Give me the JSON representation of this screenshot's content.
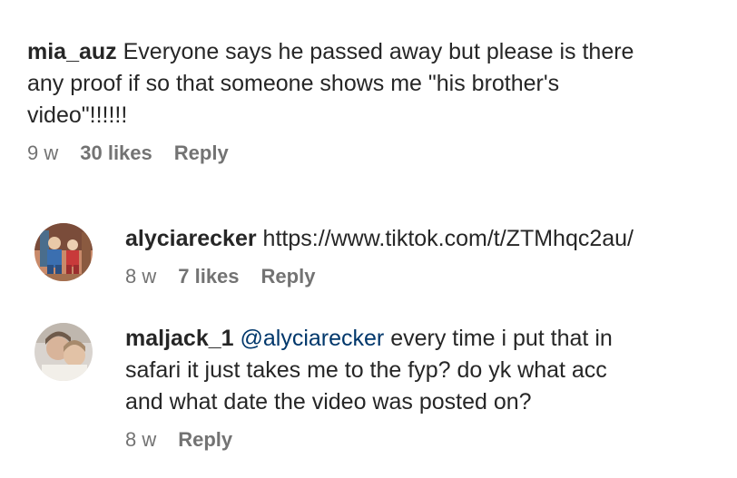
{
  "comments": [
    {
      "username": "mia_auz",
      "text_lines": [
        "Everyone says he passed away but please is there",
        "any proof if so that someone shows me \"his brother's",
        "video\"!!!!!!"
      ],
      "time": "9 w",
      "likes": "30 likes",
      "reply": "Reply"
    },
    {
      "username": "alyciarecker",
      "text": "https://www.tiktok.com/t/ZTMhqc2au/",
      "time": "8 w",
      "likes": "7 likes",
      "reply": "Reply"
    },
    {
      "username": "maljack_1",
      "mention": "@alyciarecker",
      "text_lines": [
        "every time i put that in",
        "safari it just takes me to the fyp? do yk what acc",
        "and what date the video was posted on?"
      ],
      "time": "8 w",
      "reply": "Reply"
    }
  ],
  "colors": {
    "text": "#262626",
    "muted": "#737373",
    "mention": "#00376b"
  }
}
